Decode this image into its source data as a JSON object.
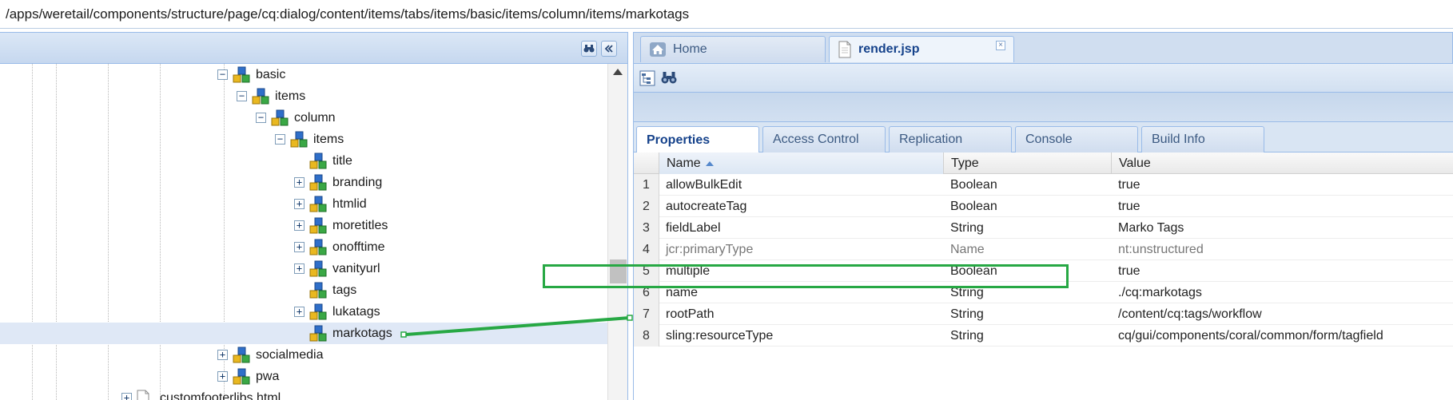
{
  "path_bar": {
    "path": "/apps/weretail/components/structure/page/cq:dialog/content/items/tabs/items/basic/items/column/items/markotags"
  },
  "tree": {
    "nodes": [
      {
        "label": "basic",
        "toggle": "minus",
        "depth": 0
      },
      {
        "label": "items",
        "toggle": "minus",
        "depth": 1
      },
      {
        "label": "column",
        "toggle": "minus",
        "depth": 2
      },
      {
        "label": "items",
        "toggle": "minus",
        "depth": 3
      },
      {
        "label": "title",
        "toggle": "none",
        "depth": 4
      },
      {
        "label": "branding",
        "toggle": "plus",
        "depth": 4
      },
      {
        "label": "htmlid",
        "toggle": "plus",
        "depth": 4
      },
      {
        "label": "moretitles",
        "toggle": "plus",
        "depth": 4
      },
      {
        "label": "onofftime",
        "toggle": "plus",
        "depth": 4
      },
      {
        "label": "vanityurl",
        "toggle": "plus",
        "depth": 4
      },
      {
        "label": "tags",
        "toggle": "none",
        "depth": 4
      },
      {
        "label": "lukatags",
        "toggle": "plus",
        "depth": 4
      },
      {
        "label": "markotags",
        "toggle": "none",
        "depth": 4,
        "selected": true
      },
      {
        "label": "socialmedia",
        "toggle": "plus",
        "depth": 0
      },
      {
        "label": "pwa",
        "toggle": "plus",
        "depth": 0
      },
      {
        "label": "customfooterlibs.html",
        "toggle": "plus",
        "depth": -5,
        "file": true
      }
    ]
  },
  "editor_tabs": [
    {
      "label": "Home",
      "icon": "home-icon"
    },
    {
      "label": "render.jsp",
      "icon": "file-icon",
      "active": true,
      "closable": true
    }
  ],
  "property_tabs": [
    "Properties",
    "Access Control",
    "Replication",
    "Console",
    "Build Info"
  ],
  "grid": {
    "columns": [
      "Name",
      "Type",
      "Value"
    ],
    "rows": [
      {
        "num": "1",
        "name": "allowBulkEdit",
        "type": "Boolean",
        "value": "true"
      },
      {
        "num": "2",
        "name": "autocreateTag",
        "type": "Boolean",
        "value": "true"
      },
      {
        "num": "3",
        "name": "fieldLabel",
        "type": "String",
        "value": "Marko Tags"
      },
      {
        "num": "4",
        "name": "jcr:primaryType",
        "type": "Name",
        "value": "nt:unstructured",
        "dim": true
      },
      {
        "num": "5",
        "name": "multiple",
        "type": "Boolean",
        "value": "true"
      },
      {
        "num": "6",
        "name": "name",
        "type": "String",
        "value": "./cq:markotags"
      },
      {
        "num": "7",
        "name": "rootPath",
        "type": "String",
        "value": "/content/cq:tags/workflow"
      },
      {
        "num": "8",
        "name": "sling:resourceType",
        "type": "String",
        "value": "cq/gui/components/coral/common/form/tagfield"
      }
    ]
  },
  "colors": {
    "highlight": "#27a844",
    "selection": "#dfe8f6",
    "accent": "#15428b"
  }
}
